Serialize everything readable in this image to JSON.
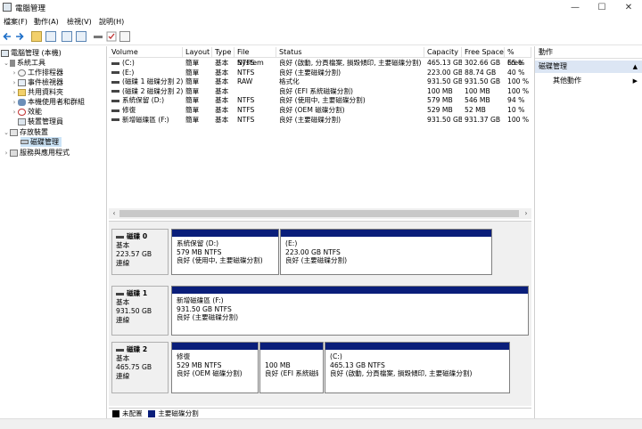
{
  "window": {
    "title": "電腦管理",
    "min_glyph": "—",
    "max_glyph": "☐",
    "close_glyph": "✕"
  },
  "menu": [
    "檔案(F)",
    "動作(A)",
    "檢視(V)",
    "說明(H)"
  ],
  "tree": {
    "root": "電腦管理 (本機)",
    "system_tools": "系統工具",
    "task_scheduler": "工作排程器",
    "event_viewer": "事件檢視器",
    "shared_folders": "共用資料夾",
    "local_users": "本機使用者和群組",
    "performance": "效能",
    "device_manager": "裝置管理員",
    "storage": "存放裝置",
    "disk_management": "磁碟管理",
    "services": "服務與應用程式"
  },
  "table": {
    "columns": [
      "Volume",
      "Layout",
      "Type",
      "File System",
      "Status",
      "Capacity",
      "Free Space",
      "% Free"
    ],
    "rows": [
      [
        "(C:)",
        "簡單",
        "基本",
        "NTFS",
        "良好 (啟動, 分頁檔案, 損毀傾印, 主要磁碟分割)",
        "465.13 GB",
        "302.66 GB",
        "65 %"
      ],
      [
        "(E:)",
        "簡單",
        "基本",
        "NTFS",
        "良好 (主要磁碟分割)",
        "223.00 GB",
        "88.74 GB",
        "40 %"
      ],
      [
        "(磁碟 1 磁碟分割 2)",
        "簡單",
        "基本",
        "RAW",
        "格式化",
        "931.50 GB",
        "931.50 GB",
        "100 %"
      ],
      [
        "(磁碟 2 磁碟分割 2)",
        "簡單",
        "基本",
        "",
        "良好 (EFI 系統磁碟分割)",
        "100 MB",
        "100 MB",
        "100 %"
      ],
      [
        "系統保留 (D:)",
        "簡單",
        "基本",
        "NTFS",
        "良好 (使用中, 主要磁碟分割)",
        "579 MB",
        "546 MB",
        "94 %"
      ],
      [
        "修復",
        "簡單",
        "基本",
        "NTFS",
        "良好 (OEM 磁碟分割)",
        "529 MB",
        "52 MB",
        "10 %"
      ],
      [
        "新增磁碟區 (F:)",
        "簡單",
        "基本",
        "NTFS",
        "良好 (主要磁碟分割)",
        "931.50 GB",
        "931.37 GB",
        "100 %"
      ]
    ]
  },
  "scroll": {
    "left": "‹",
    "right": "›"
  },
  "disks": [
    {
      "name": "磁碟 0",
      "type": "基本",
      "size": "223.57 GB",
      "state": "連線",
      "partitions": [
        {
          "name": "系統保留 (D:)",
          "size": "579 MB NTFS",
          "status": "良好 (使用中, 主要磁碟分割)"
        },
        {
          "name": "(E:)",
          "size": "223.00 GB NTFS",
          "status": "良好 (主要磁碟分割)"
        }
      ]
    },
    {
      "name": "磁碟 1",
      "type": "基本",
      "size": "931.50 GB",
      "state": "連線",
      "partitions": [
        {
          "name": "新增磁碟區 (F:)",
          "size": "931.50 GB NTFS",
          "status": "良好 (主要磁碟分割)"
        }
      ]
    },
    {
      "name": "磁碟 2",
      "type": "基本",
      "size": "465.75 GB",
      "state": "連線",
      "partitions": [
        {
          "name": "修復",
          "size": "529 MB NTFS",
          "status": "良好 (OEM 磁碟分割)"
        },
        {
          "name": "",
          "size": "100 MB",
          "status": "良好 (EFI 系統磁碟"
        },
        {
          "name": "(C:)",
          "size": "465.13 GB NTFS",
          "status": "良好 (啟動, 分頁檔案, 損毀傾印, 主要磁碟分割)"
        }
      ]
    }
  ],
  "legend": {
    "unallocated": "未配置",
    "primary": "主要磁碟分割",
    "unallocated_color": "#000000",
    "primary_color": "#0a1e7a"
  },
  "actions": {
    "header": "動作",
    "section": "磁碟管理",
    "more": "其他動作"
  },
  "colors": {
    "partition_bar": "#0a1e7a",
    "selection": "#cce4f7"
  }
}
